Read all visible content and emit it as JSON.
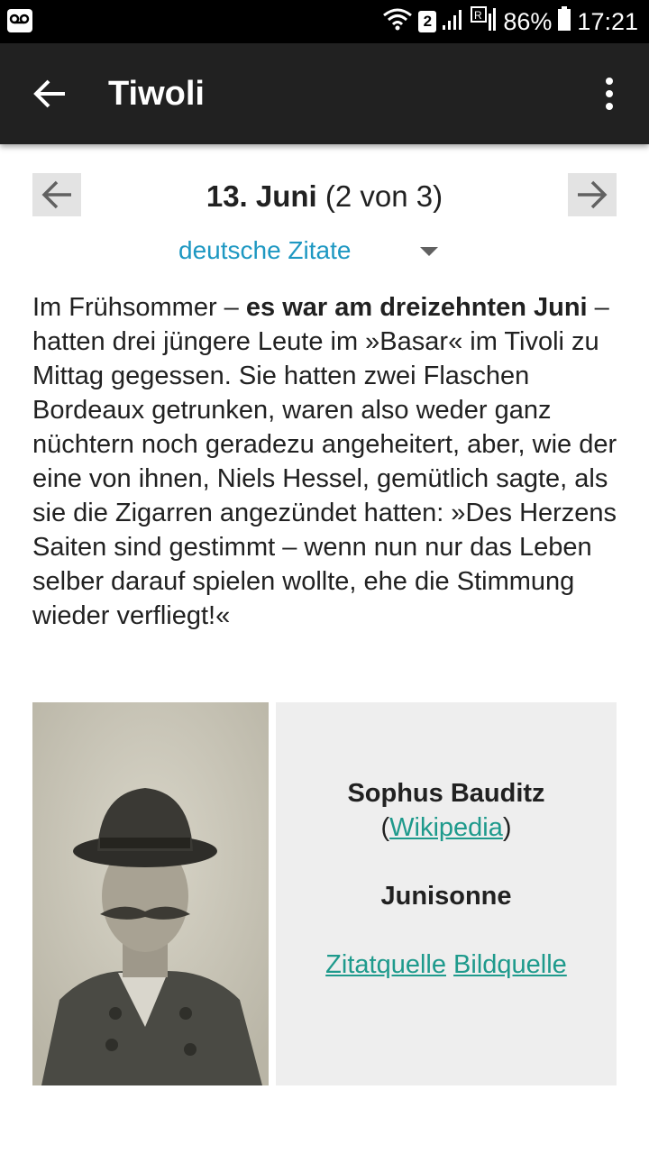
{
  "status_bar": {
    "sim_badge": "2",
    "battery_percent": "86%",
    "time": "17:21",
    "icons": [
      "voicemail-icon",
      "wifi-icon",
      "signal-icon",
      "roaming-signal-icon",
      "battery-icon"
    ]
  },
  "app_bar": {
    "title": "Tiwoli",
    "back_icon": "arrow-left-icon",
    "menu_icon": "more-vert-icon"
  },
  "date_nav": {
    "date": "13. Juni",
    "position": "(2 von 3)",
    "prev_icon": "arrow-left-icon",
    "next_icon": "arrow-right-icon"
  },
  "language_select": {
    "selected": "deutsche Zitate"
  },
  "quote": {
    "part1": "Im Frühsommer – ",
    "highlight": "es war am dreizehnten Juni",
    "part2": " – hatten drei jüngere Leute im »Basar« im Tivoli zu Mittag gegessen. Sie hatten zwei Flaschen Bordeaux getrunken, waren also weder ganz nüchtern noch geradezu angeheitert, aber, wie der eine von ihnen, Niels Hessel, gemütlich sagte, als sie die Zigarren angezündet hatten: »Des Herzens Saiten sind gestimmt – wenn nun nur das Leben selber darauf spielen wollte, ehe die Stimmung wieder verfliegt!«"
  },
  "author_card": {
    "author": "Sophus Bauditz",
    "open_paren": "(",
    "wikipedia_link": "Wikipedia",
    "close_paren": ")",
    "work": "Junisonne",
    "quote_source_link": "Zitatquelle",
    "image_source_link": "Bildquelle"
  },
  "colors": {
    "app_bar_bg": "#212121",
    "accent_link": "#1e9a8c",
    "select_text": "#1e98c2",
    "panel_bg": "#eeeeee"
  }
}
